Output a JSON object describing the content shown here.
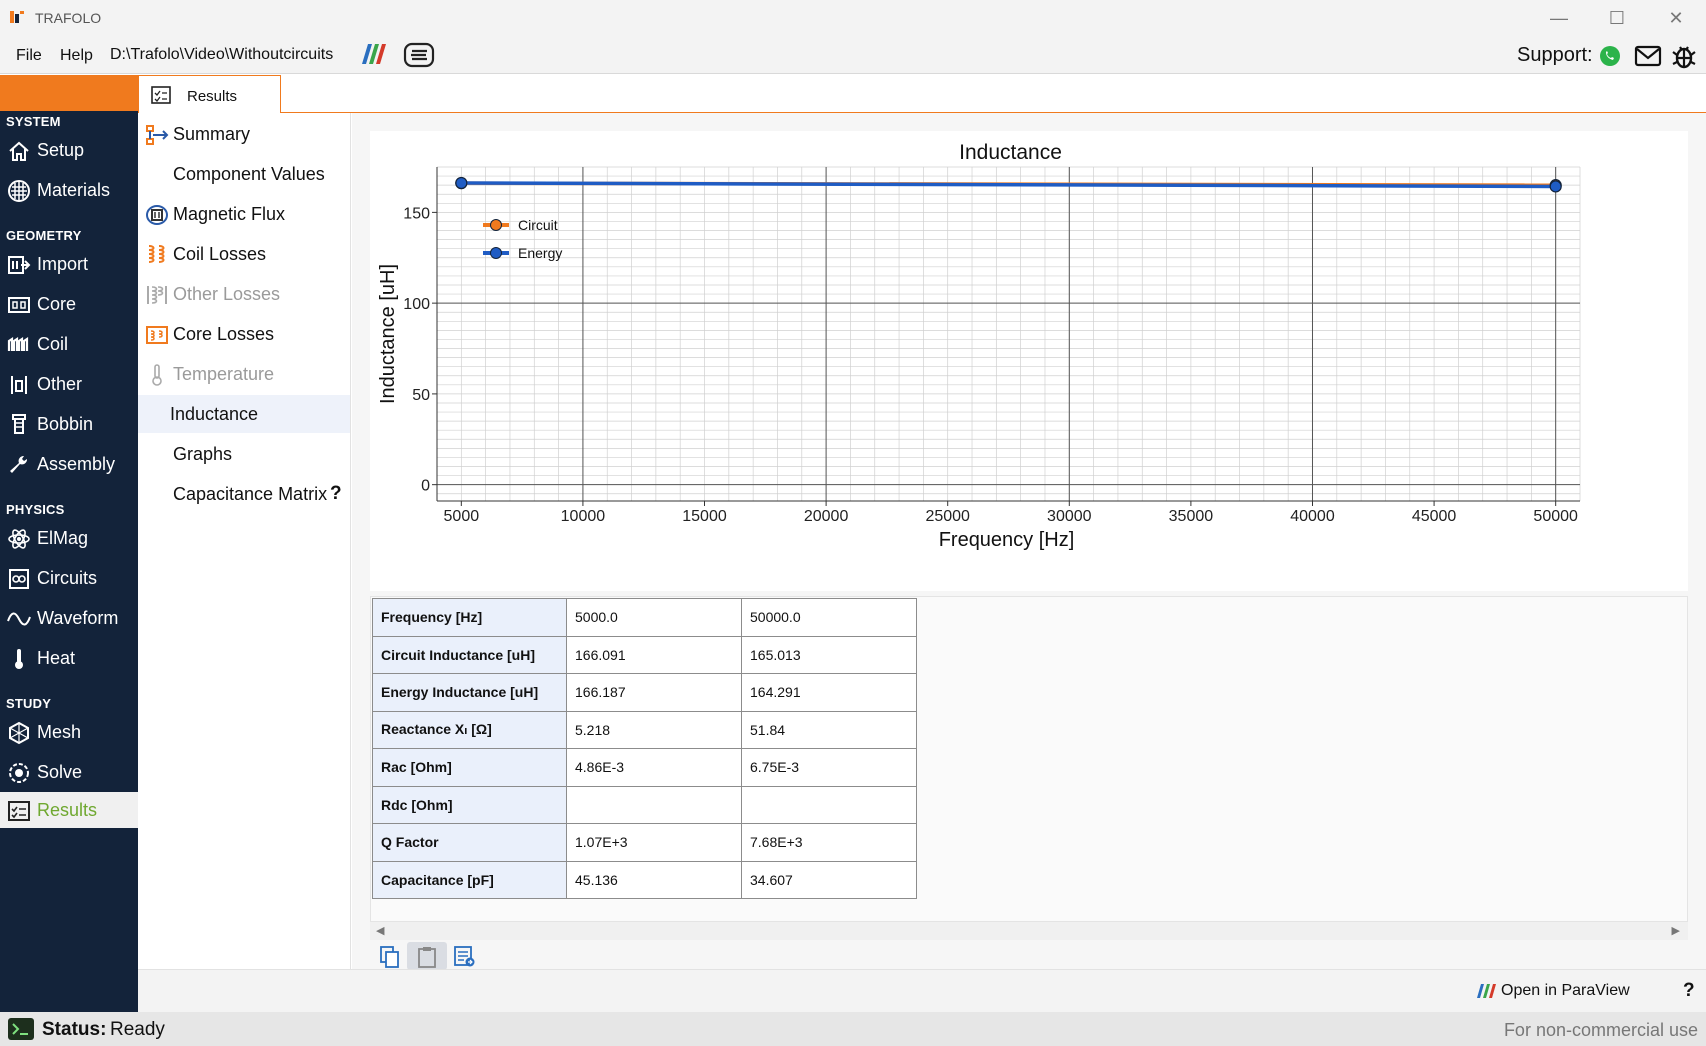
{
  "window": {
    "title": "TRAFOLO",
    "controls": [
      "minimize",
      "maximize",
      "close"
    ]
  },
  "menu": {
    "file": "File",
    "help": "Help",
    "path": "D:\\Trafolo\\Video\\Withoutcircuits",
    "support_label": "Support:"
  },
  "sidebar": {
    "sections": [
      {
        "label": "SYSTEM",
        "items": [
          {
            "label": "Setup",
            "icon": "home-icon"
          },
          {
            "label": "Materials",
            "icon": "materials-icon"
          }
        ]
      },
      {
        "label": "GEOMETRY",
        "items": [
          {
            "label": "Import",
            "icon": "import-icon"
          },
          {
            "label": "Core",
            "icon": "core-icon"
          },
          {
            "label": "Coil",
            "icon": "coil-icon"
          },
          {
            "label": "Other",
            "icon": "other-icon"
          },
          {
            "label": "Bobbin",
            "icon": "bobbin-icon"
          },
          {
            "label": "Assembly",
            "icon": "wrench-icon"
          }
        ]
      },
      {
        "label": "PHYSICS",
        "items": [
          {
            "label": "ElMag",
            "icon": "atom-icon"
          },
          {
            "label": "Circuits",
            "icon": "circuits-icon"
          },
          {
            "label": "Waveform",
            "icon": "waveform-icon"
          },
          {
            "label": "Heat",
            "icon": "thermometer-icon"
          }
        ]
      },
      {
        "label": "STUDY",
        "items": [
          {
            "label": "Mesh",
            "icon": "mesh-icon"
          },
          {
            "label": "Solve",
            "icon": "solve-icon"
          },
          {
            "label": "Results",
            "icon": "results-icon"
          }
        ]
      }
    ],
    "active": "Results"
  },
  "results_tab": {
    "label": "Results"
  },
  "results_nav": {
    "items": [
      {
        "label": "Summary",
        "state": "normal"
      },
      {
        "label": "Component Values",
        "state": "normal"
      },
      {
        "label": "Magnetic Flux",
        "state": "normal"
      },
      {
        "label": "Coil Losses",
        "state": "normal"
      },
      {
        "label": "Other Losses",
        "state": "disabled"
      },
      {
        "label": "Core Losses",
        "state": "normal"
      },
      {
        "label": "Temperature",
        "state": "disabled"
      },
      {
        "label": "Inductance",
        "state": "selected"
      },
      {
        "label": "Graphs",
        "state": "normal"
      },
      {
        "label": "Capacitance Matrix",
        "state": "normal"
      }
    ],
    "help_glyph": "?"
  },
  "chart_data": {
    "type": "line",
    "title": "Inductance",
    "xlabel": "Frequency [Hz]",
    "ylabel": "Inductance [uH]",
    "xlim": [
      4000,
      51000
    ],
    "ylim": [
      -9,
      175
    ],
    "xticks": [
      5000,
      10000,
      15000,
      20000,
      25000,
      30000,
      35000,
      40000,
      45000,
      50000
    ],
    "yticks": [
      0,
      50,
      100,
      150
    ],
    "grid": true,
    "legend_position": "upper-left",
    "series": [
      {
        "name": "Circuit",
        "color": "#f07a1e",
        "x": [
          5000,
          50000
        ],
        "y": [
          166.091,
          165.013
        ]
      },
      {
        "name": "Energy",
        "color": "#1f5cc4",
        "x": [
          5000,
          50000
        ],
        "y": [
          166.187,
          164.291
        ]
      }
    ]
  },
  "table": {
    "rows": [
      {
        "label": "Frequency [Hz]",
        "values": [
          "5000.0",
          "50000.0"
        ]
      },
      {
        "label": "Circuit Inductance [uH]",
        "values": [
          "166.091",
          "165.013"
        ]
      },
      {
        "label": "Energy Inductance [uH]",
        "values": [
          "166.187",
          "164.291"
        ]
      },
      {
        "label": "Reactance Xₗ [Ω]",
        "values": [
          "5.218",
          "51.84"
        ]
      },
      {
        "label": "Rac [Ohm]",
        "values": [
          "4.86E-3",
          "6.75E-3"
        ]
      },
      {
        "label": "Rdc [Ohm]",
        "values": [
          "",
          ""
        ]
      },
      {
        "label": "Q Factor",
        "values": [
          "1.07E+3",
          "7.68E+3"
        ]
      },
      {
        "label": "Capacitance [pF]",
        "values": [
          "45.136",
          "34.607"
        ]
      }
    ]
  },
  "bottom": {
    "paraview_label": "Open in ParaView",
    "help": "?"
  },
  "status": {
    "label": "Status:",
    "value": "Ready",
    "license": "For non-commercial use"
  },
  "colors": {
    "accent": "#f07a1e",
    "sidebar_bg": "#13233a",
    "active_text": "#6fa830",
    "series_circuit": "#f07a1e",
    "series_energy": "#1f5cc4"
  }
}
